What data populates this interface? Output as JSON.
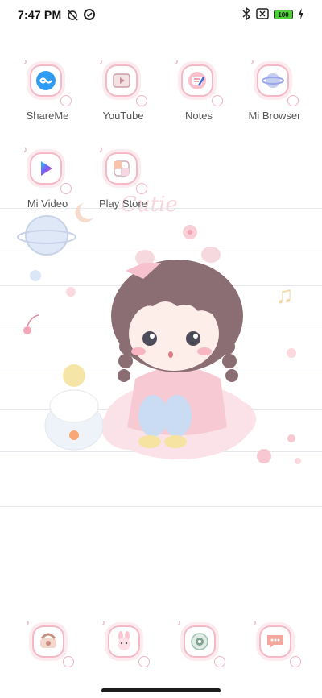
{
  "status_bar": {
    "time": "7:47 PM",
    "battery_level": "100",
    "left_icons": [
      "alarm-off-icon",
      "data-saver-icon"
    ],
    "right_icons": [
      "bluetooth-icon",
      "no-sim-icon",
      "battery-icon",
      "charging-icon"
    ]
  },
  "apps": [
    {
      "label": "ShareMe",
      "icon": "shareme-icon"
    },
    {
      "label": "YouTube",
      "icon": "youtube-icon"
    },
    {
      "label": "Notes",
      "icon": "notes-icon"
    },
    {
      "label": "Mi Browser",
      "icon": "mi-browser-icon"
    },
    {
      "label": "Mi Video",
      "icon": "mi-video-icon"
    },
    {
      "label": "Play Store",
      "icon": "play-store-icon"
    }
  ],
  "dock": [
    {
      "icon": "phone-icon"
    },
    {
      "icon": "contacts-icon"
    },
    {
      "icon": "camera-icon"
    },
    {
      "icon": "messages-icon"
    }
  ],
  "wallpaper": {
    "text": "Cutie",
    "colors": {
      "pink": "#f7c9d3",
      "hair": "#8b6e74",
      "lines": "#e7e7ee"
    }
  }
}
